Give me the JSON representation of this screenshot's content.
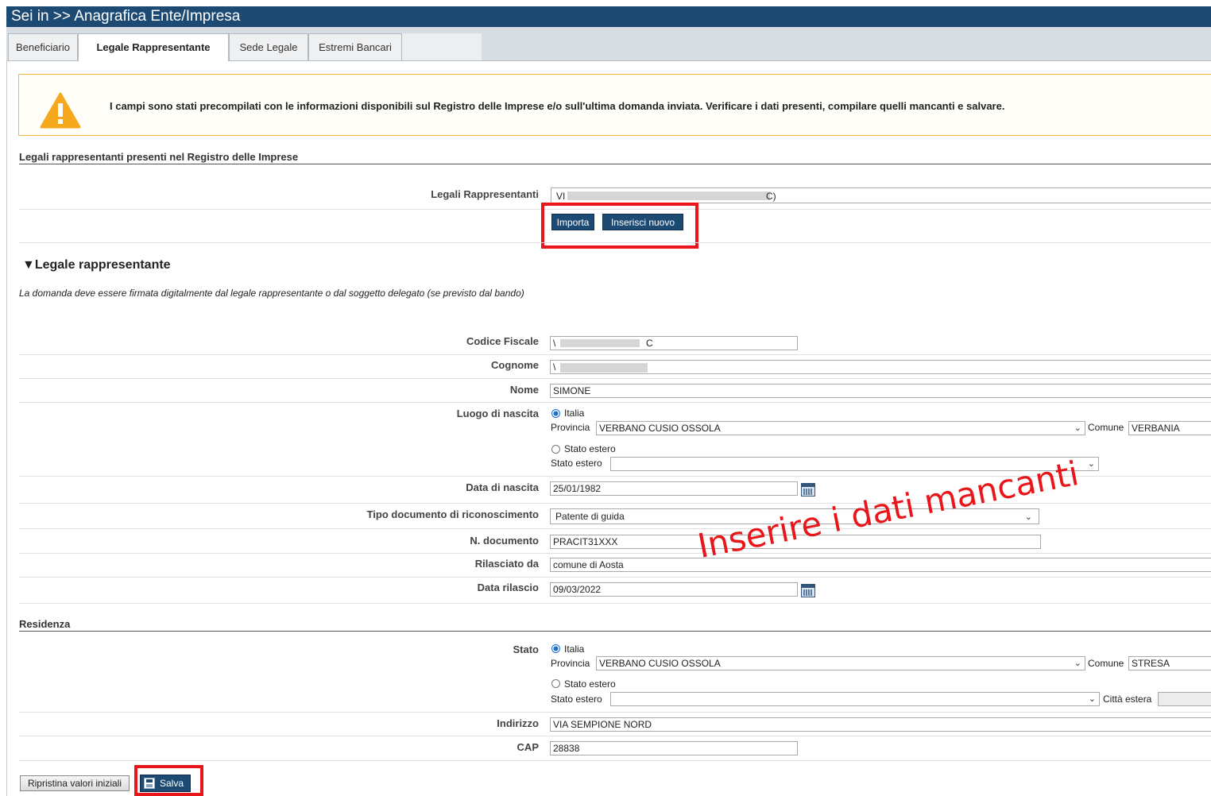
{
  "header": {
    "breadcrumb": "Sei in >> Anagrafica Ente/Impresa"
  },
  "tabs": [
    {
      "label": "Beneficiario"
    },
    {
      "label": "Legale Rappresentante"
    },
    {
      "label": "Sede Legale"
    },
    {
      "label": "Estremi Bancari"
    }
  ],
  "warning": {
    "text": "I campi sono stati precompilati con le informazioni disponibili sul Registro delle Imprese e/o sull'ultima domanda inviata. Verificare i dati presenti, compilare quelli mancanti e salvare."
  },
  "registro": {
    "title": "Legali rappresentanti presenti nel Registro delle Imprese",
    "label": "Legali Rappresentanti",
    "value_prefix": "VI",
    "value_suffix": "C)",
    "btn_importa": "Importa",
    "btn_inserisci": "Inserisci nuovo"
  },
  "legale": {
    "title": "▼Legale rappresentante",
    "note": "La domanda deve essere firmata digitalmente dal legale rappresentante o dal soggetto delegato (se previsto dal bando)",
    "codice_fiscale_label": "Codice Fiscale",
    "codice_fiscale_prefix": "\\",
    "codice_fiscale_suffix": "C",
    "cognome_label": "Cognome",
    "cognome_prefix": "\\",
    "nome_label": "Nome",
    "nome_value": "SIMONE",
    "luogo_label": "Luogo di nascita",
    "italia_label": "Italia",
    "provincia_label": "Provincia",
    "provincia_value": "VERBANO CUSIO OSSOLA",
    "comune_label": "Comune",
    "comune_value": "VERBANIA",
    "stato_estero_radio": "Stato estero",
    "stato_estero_label": "Stato estero",
    "data_nascita_label": "Data di nascita",
    "data_nascita_value": "25/01/1982",
    "tipo_doc_label": "Tipo documento di riconoscimento",
    "tipo_doc_value": "Patente di guida",
    "n_doc_label": "N. documento",
    "n_doc_value": "PRACIT31XXX",
    "rilasciato_label": "Rilasciato da",
    "rilasciato_value": "comune di Aosta",
    "data_rilascio_label": "Data rilascio",
    "data_rilascio_value": "09/03/2022"
  },
  "residenza": {
    "title": "Residenza",
    "stato_label": "Stato",
    "italia_label": "Italia",
    "provincia_label": "Provincia",
    "provincia_value": "VERBANO CUSIO OSSOLA",
    "comune_label": "Comune",
    "comune_value": "STRESA",
    "stato_estero_radio": "Stato estero",
    "stato_estero_label": "Stato estero",
    "citta_estera_label": "Città estera",
    "indirizzo_label": "Indirizzo",
    "indirizzo_value": "VIA SEMPIONE NORD",
    "cap_label": "CAP",
    "cap_value": "28838"
  },
  "footer": {
    "btn_ripristina": "Ripristina valori iniziali",
    "btn_salva": "Salva"
  },
  "annotation": {
    "text": "Inserire i dati mancanti",
    "color": "#e8151a"
  }
}
